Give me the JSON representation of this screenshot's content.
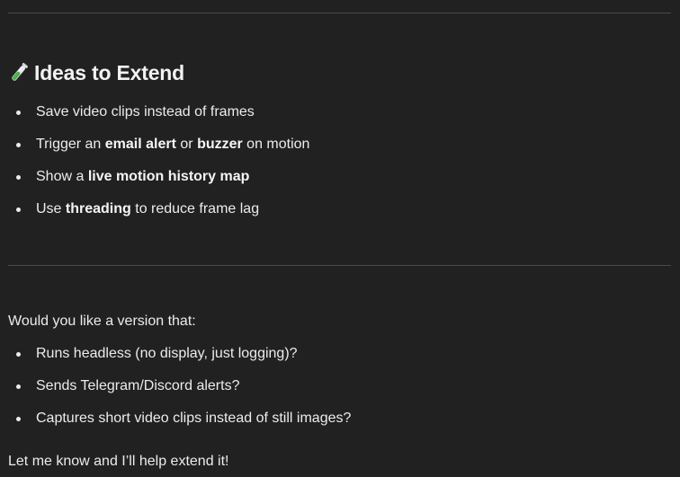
{
  "section": {
    "heading": "Ideas to Extend",
    "heading_icon": "test-tube-icon"
  },
  "ideas": {
    "items": [
      {
        "pre": "Save video clips instead of frames",
        "b1": "",
        "mid": "",
        "b2": "",
        "post": ""
      },
      {
        "pre": "Trigger an ",
        "b1": "email alert",
        "mid": " or ",
        "b2": "buzzer",
        "post": " on motion"
      },
      {
        "pre": "Show a ",
        "b1": "live motion history map",
        "mid": "",
        "b2": "",
        "post": ""
      },
      {
        "pre": "Use ",
        "b1": "threading",
        "mid": " to reduce frame lag",
        "b2": "",
        "post": ""
      }
    ]
  },
  "followup": {
    "question": "Would you like a version that:",
    "items": [
      "Runs headless (no display, just logging)?",
      "Sends Telegram/Discord alerts?",
      "Captures short video clips instead of still images?"
    ],
    "closing": "Let me know and I’ll help extend it!"
  },
  "colors": {
    "background": "#212121",
    "text": "#ececec",
    "divider": "#4a4a4a",
    "icon_green": "#4caf50"
  }
}
